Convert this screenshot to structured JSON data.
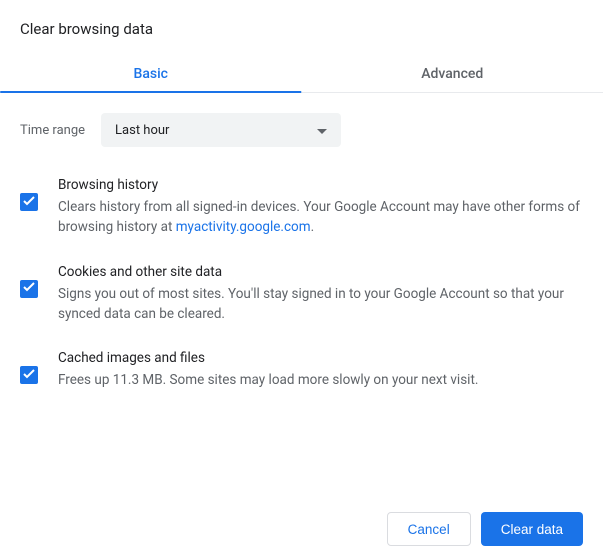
{
  "title": "Clear browsing data",
  "tabs": {
    "basic": "Basic",
    "advanced": "Advanced"
  },
  "time_range": {
    "label": "Time range",
    "selected": "Last hour"
  },
  "options": [
    {
      "title": "Browsing history",
      "desc_pre": "Clears history from all signed-in devices. Your Google Account may have other forms of browsing history at ",
      "link_text": "myactivity.google.com",
      "desc_post": "."
    },
    {
      "title": "Cookies and other site data",
      "desc": "Signs you out of most sites. You'll stay signed in to your Google Account so that your synced data can be cleared."
    },
    {
      "title": "Cached images and files",
      "desc": "Frees up 11.3 MB. Some sites may load more slowly on your next visit."
    }
  ],
  "buttons": {
    "cancel": "Cancel",
    "clear": "Clear data"
  },
  "colors": {
    "accent": "#1a73e8",
    "text_secondary": "#5f6368"
  }
}
